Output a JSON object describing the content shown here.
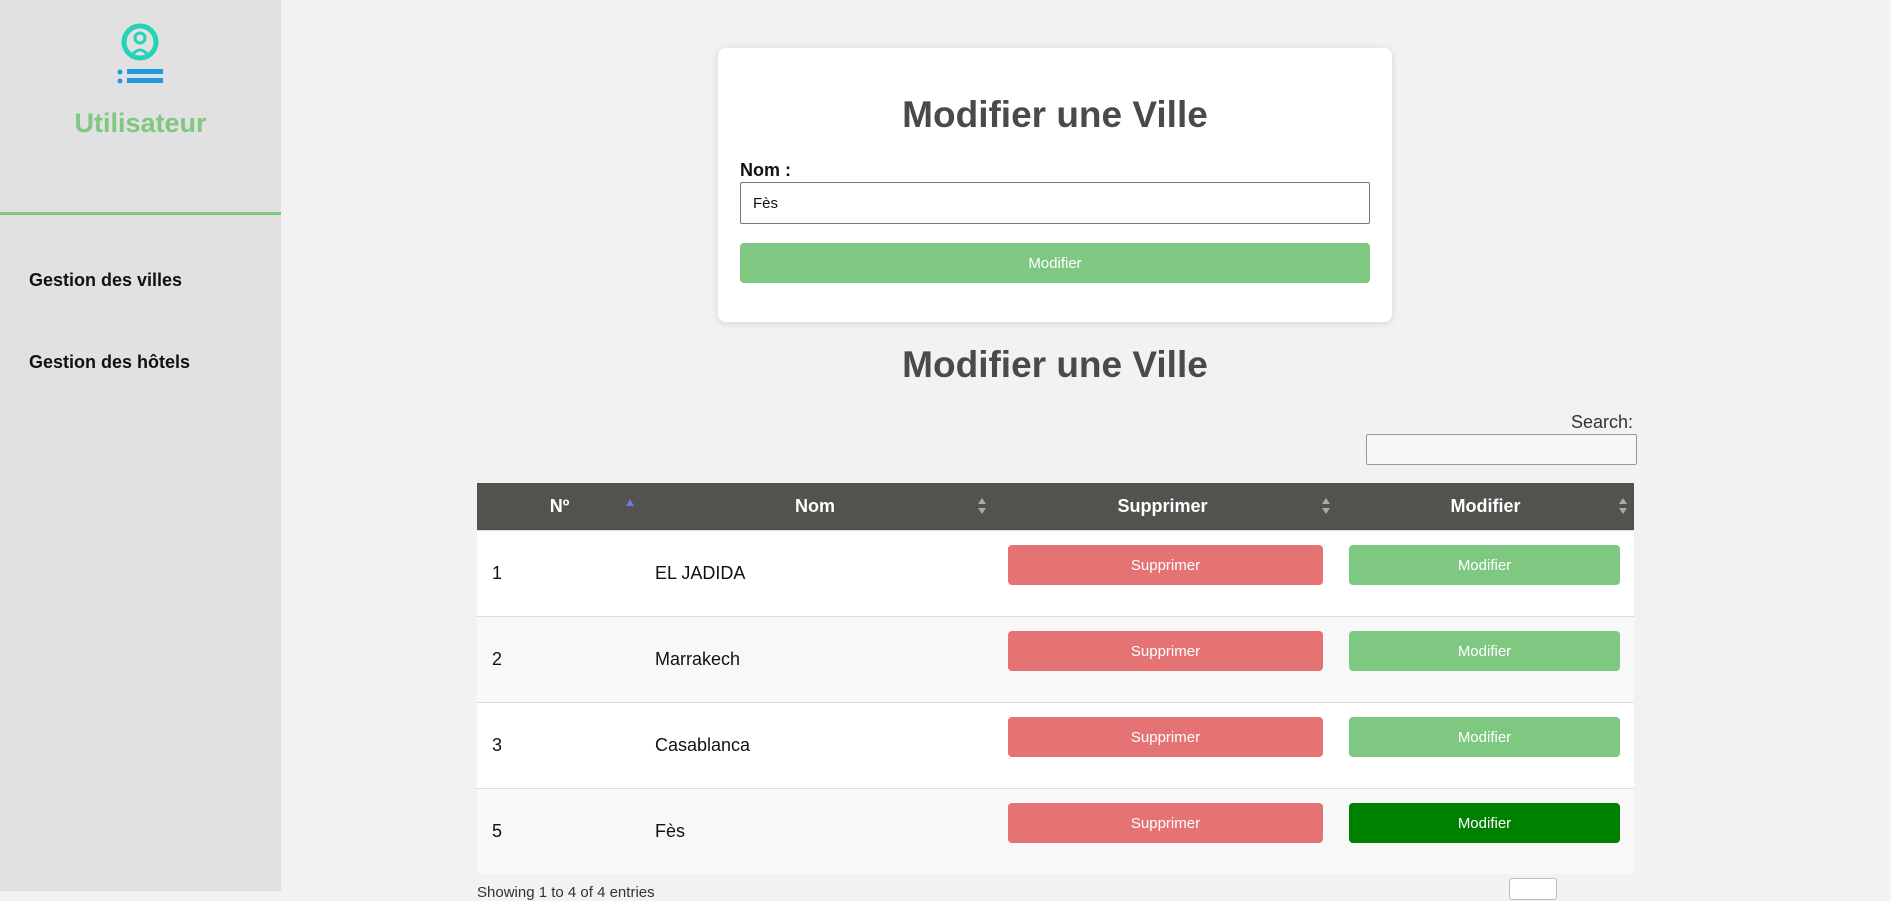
{
  "sidebar": {
    "brand": "Utilisateur",
    "logo_icon": "user-list-icon",
    "items": [
      {
        "label": "Gestion des villes"
      },
      {
        "label": "Gestion des hôtels"
      }
    ]
  },
  "form": {
    "title": "Modifier une Ville",
    "field_label": "Nom :",
    "field_value": "Fès",
    "submit_label": "Modifier"
  },
  "list": {
    "title": "Modifier une Ville",
    "search_label": "Search:",
    "columns": [
      "Nº",
      "Nom",
      "Supprimer",
      "Modifier"
    ],
    "rows": [
      {
        "no": "1",
        "nom": "EL JADIDA",
        "delete_label": "Supprimer",
        "edit_label": "Modifier"
      },
      {
        "no": "2",
        "nom": "Marrakech",
        "delete_label": "Supprimer",
        "edit_label": "Modifier"
      },
      {
        "no": "3",
        "nom": "Casablanca",
        "delete_label": "Supprimer",
        "edit_label": "Modifier"
      },
      {
        "no": "5",
        "nom": "Fès",
        "delete_label": "Supprimer",
        "edit_label": "Modifier"
      }
    ],
    "info": "Showing 1 to 4 of 4 entries"
  },
  "colors": {
    "accent_green": "#7ec882",
    "active_green": "#008000",
    "danger_red": "#e67373",
    "header_dark": "#54524f",
    "logo_teal": "#27d3b6",
    "logo_blue": "#1e9be0"
  }
}
